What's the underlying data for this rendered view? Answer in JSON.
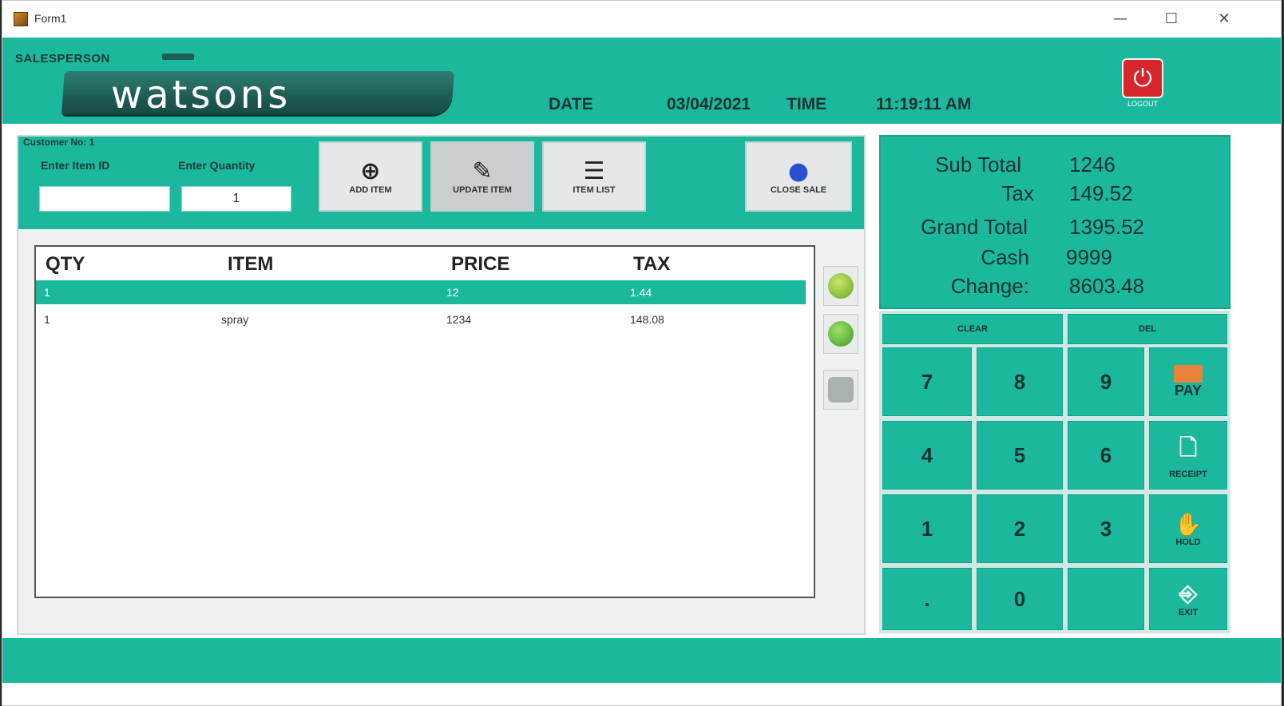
{
  "window": {
    "title": "Form1",
    "minimize": "—",
    "maximize": "☐",
    "close": "✕"
  },
  "header": {
    "salesperson_label": "SALESPERSON",
    "logo": "watsons",
    "date_label": "DATE",
    "date_value": "03/04/2021",
    "time_label": "TIME",
    "time_value": "11:19:11 AM",
    "logout_label": "LOGOUT",
    "logout_icon": "power-icon"
  },
  "entry": {
    "customer_label": "Customer No: 1",
    "item_id_label": "Enter Item ID",
    "item_id_value": "",
    "quantity_label": "Enter Quantity",
    "quantity_value": "1"
  },
  "toolbar": {
    "add_item": "ADD ITEM",
    "update_item": "UPDATE ITEM",
    "item_list": "ITEM LIST",
    "close_sale": "CLOSE SALE"
  },
  "grid": {
    "columns": [
      "QTY",
      "ITEM",
      "PRICE",
      "TAX"
    ],
    "rows": [
      {
        "qty": "1",
        "item": "",
        "price": "12",
        "tax": "1.44"
      },
      {
        "qty": "1",
        "item": "spray",
        "price": "1234",
        "tax": "148.08"
      }
    ]
  },
  "side_buttons": [
    {
      "icon": "green-circle-icon",
      "color": "#7bc142"
    },
    {
      "icon": "green-circle-icon",
      "color": "#4fbf3a"
    },
    {
      "icon": "stop-icon",
      "color": "#9aa3a2"
    }
  ],
  "totals": {
    "subtotal_label": "Sub Total",
    "subtotal_value": "1246",
    "tax_label": "Tax",
    "tax_value": "149.52",
    "grand_total_label": "Grand Total",
    "grand_total_value": "1395.52",
    "cash_label": "Cash",
    "cash_value": "9999",
    "change_label": "Change:",
    "change_value": "8603.48"
  },
  "keypad": {
    "clear": "CLEAR",
    "delete": "DEL",
    "keys": [
      "7",
      "8",
      "9",
      "4",
      "5",
      "6",
      "1",
      "2",
      "3",
      ".",
      "0",
      ""
    ],
    "pay": "PAY",
    "receipt": "RECEIPT",
    "hold": "HOLD",
    "exit": "EXIT"
  },
  "colors": {
    "accent": "#1bb89e",
    "logout": "#d8262d"
  }
}
